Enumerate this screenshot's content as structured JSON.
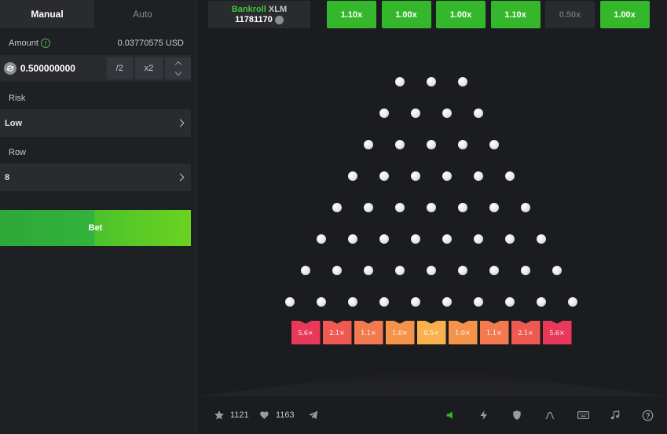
{
  "tabs": {
    "manual": "Manual",
    "auto": "Auto"
  },
  "amount": {
    "label": "Amount",
    "usd": "0.03770575 USD",
    "value": "0.500000000",
    "half": "/2",
    "double": "x2"
  },
  "risk": {
    "label": "Risk",
    "value": "Low"
  },
  "row": {
    "label": "Row",
    "value": "8"
  },
  "bet": {
    "label": "Bet"
  },
  "bankroll": {
    "label": "Bankroll",
    "currency": "XLM",
    "amount": "11781170"
  },
  "history": [
    {
      "value": "1.10x",
      "status": "win"
    },
    {
      "value": "1.00x",
      "status": "win"
    },
    {
      "value": "1.00x",
      "status": "win"
    },
    {
      "value": "1.10x",
      "status": "win"
    },
    {
      "value": "0.50x",
      "status": "lose"
    },
    {
      "value": "1.00x",
      "status": "win"
    }
  ],
  "board": {
    "peg_rows": [
      3,
      4,
      5,
      6,
      7,
      8,
      9,
      10
    ],
    "buckets": [
      {
        "label": "5.6×",
        "color": "#e8395b"
      },
      {
        "label": "2.1×",
        "color": "#ee5a52"
      },
      {
        "label": "1.1×",
        "color": "#f37a4f"
      },
      {
        "label": "1.0×",
        "color": "#f5934a"
      },
      {
        "label": "0.5×",
        "color": "#f8b14c"
      },
      {
        "label": "1.0×",
        "color": "#f5934a"
      },
      {
        "label": "1.1×",
        "color": "#f37a4f"
      },
      {
        "label": "2.1×",
        "color": "#ee5a52"
      },
      {
        "label": "5.6×",
        "color": "#e8395b"
      }
    ]
  },
  "footer": {
    "likes": "1121",
    "hearts": "1163"
  },
  "colors": {
    "accent_green": "#35b72c",
    "panel": "#2a2b2f",
    "background": "#1b1c1f"
  }
}
